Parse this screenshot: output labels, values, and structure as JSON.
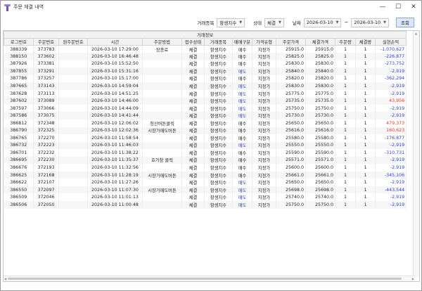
{
  "window": {
    "title": "주문 체결 내역",
    "controls": {
      "minimize": "—",
      "maximize": "☐",
      "close": "✕"
    }
  },
  "toolbar": {
    "product_label": "거래종목",
    "product_value": "항셍지수",
    "status_label": "상태",
    "status_value": "체결",
    "date_label": "날짜",
    "date_from": "2026-03-10",
    "date_sep": "~",
    "date_to": "2026-03-10",
    "search_label": "조회"
  },
  "grid": {
    "group_header": "거래정보",
    "columns": [
      "로그번호",
      "주문번호",
      "원주문번호",
      "시간",
      "주문방법",
      "접수상태",
      "거래종목",
      "매매구분",
      "가격유형",
      "주문가격",
      "체결가격",
      "주문량",
      "체결량",
      "실현손익"
    ],
    "rows": [
      [
        "388339",
        "373783",
        "",
        "2026-03-10 17:29:00",
        "장종료",
        "체결",
        "항셍지수",
        "매수",
        "지정가",
        "25915.0",
        "25915.0",
        "1",
        "1",
        "-1,070,627"
      ],
      [
        "388150",
        "373602",
        "",
        "2026-03-10 16:46:48",
        "",
        "체결",
        "항셍지수",
        "매수",
        "지정가",
        "25825.0",
        "25825.0",
        "1",
        "1",
        "-226,877"
      ],
      [
        "387926",
        "373381",
        "",
        "2026-03-10 15:52:50",
        "",
        "체결",
        "항셍지수",
        "매수",
        "지정가",
        "25830.0",
        "25830.0",
        "1",
        "1",
        "-273,752"
      ],
      [
        "387855",
        "373291",
        "",
        "2026-03-10 15:31:16",
        "",
        "체결",
        "항셍지수",
        "매도",
        "지정가",
        "25840.0",
        "25840.0",
        "1",
        "1",
        "-2,919"
      ],
      [
        "387786",
        "373257",
        "",
        "2026-03-10 15:17:00",
        "",
        "체결",
        "항셍지수",
        "매수",
        "지정가",
        "25820.0",
        "25820.0",
        "1",
        "1",
        "-362,294"
      ],
      [
        "387665",
        "373143",
        "",
        "2026-03-10 14:59:04",
        "",
        "체결",
        "항셍지수",
        "매도",
        "지정가",
        "25830.0",
        "25830.0",
        "1",
        "1",
        "-2,919"
      ],
      [
        "387628",
        "373113",
        "",
        "2026-03-10 14:51:25",
        "",
        "체결",
        "항셍지수",
        "매도",
        "지정가",
        "25775.0",
        "25775.0",
        "1",
        "1",
        "-2,919"
      ],
      [
        "387602",
        "373089",
        "",
        "2026-03-10 14:46:00",
        "",
        "체결",
        "항셍지수",
        "매도",
        "지정가",
        "25735.0",
        "25735.0",
        "1",
        "1",
        "43,956"
      ],
      [
        "387597",
        "373066",
        "",
        "2026-03-10 14:44:09",
        "",
        "체결",
        "항셍지수",
        "매도",
        "지정가",
        "25750.0",
        "25750.0",
        "1",
        "1",
        "-2,919"
      ],
      [
        "387586",
        "373075",
        "",
        "2026-03-10 14:41:44",
        "",
        "체결",
        "항셍지수",
        "매도",
        "지정가",
        "25730.0",
        "25730.0",
        "1",
        "1",
        "-2,919"
      ],
      [
        "386812",
        "372348",
        "",
        "2026-03-10 12:06:02",
        "청산버튼클릭",
        "체결",
        "항셍지수",
        "매수",
        "지정가",
        "25650.0",
        "25650.0",
        "1",
        "1",
        "479,373"
      ],
      [
        "386790",
        "372325",
        "",
        "2026-03-10 12:02:36",
        "시장가매도버튼",
        "체결",
        "항셍지수",
        "매수",
        "지정가",
        "25616.0",
        "25616.0",
        "1",
        "1",
        "160,623"
      ],
      [
        "386765",
        "372270",
        "",
        "2026-03-10 11:58:54",
        "",
        "체결",
        "항셍지수",
        "매수",
        "지정가",
        "25580.0",
        "25580.0",
        "1",
        "1",
        "-176,877"
      ],
      [
        "386732",
        "372223",
        "",
        "2026-03-10 11:46:03",
        "",
        "체결",
        "항셍지수",
        "매도",
        "지정가",
        "25550.0",
        "25550.0",
        "1",
        "1",
        "-2,919"
      ],
      [
        "386701",
        "372232",
        "",
        "2026-03-10 11:38:22",
        "",
        "체결",
        "항셍지수",
        "매수",
        "지정가",
        "25590.0",
        "25590.0",
        "1",
        "1",
        "-310,731"
      ],
      [
        "386695",
        "372230",
        "",
        "2026-03-10 11:35:37",
        "호가창 클릭",
        "체결",
        "항셍지수",
        "매수",
        "지정가",
        "25571.0",
        "25571.0",
        "1",
        "1",
        "-2,919"
      ],
      [
        "386676",
        "372193",
        "",
        "2026-03-10 11:32:56",
        "",
        "체결",
        "항셍지수",
        "매수",
        "지정가",
        "25600.0",
        "25600.0",
        "1",
        "1",
        "-2,919"
      ],
      [
        "386625",
        "372168",
        "",
        "2026-03-10 11:28:19",
        "시장가매도버튼",
        "체결",
        "항셍지수",
        "매수",
        "지정가",
        "25661.0",
        "25661.0",
        "1",
        "1",
        "-345,106"
      ],
      [
        "386622",
        "372107",
        "",
        "2026-03-10 11:27:26",
        "",
        "체결",
        "항셍지수",
        "매도",
        "지정가",
        "25650.0",
        "25650.0",
        "1",
        "1",
        "-2,919"
      ],
      [
        "386550",
        "372097",
        "",
        "2026-03-10 11:07:30",
        "시장가매도버튼",
        "체결",
        "항셍지수",
        "매도",
        "지정가",
        "25698.0",
        "25698.0",
        "1",
        "1",
        "-443,544"
      ],
      [
        "386509",
        "372046",
        "",
        "2026-03-10 11:01:13",
        "",
        "체결",
        "항셍지수",
        "매도",
        "지정가",
        "25740.0",
        "25740.0",
        "1",
        "1",
        "-2,919"
      ],
      [
        "386506",
        "372050",
        "",
        "2026-03-10 11:00:48",
        "",
        "체결",
        "항셍지수",
        "매도",
        "지정가",
        "25750.0",
        "25750.0",
        "1",
        "1",
        "-2,919"
      ]
    ]
  },
  "colors": {
    "loss": "#2a3fc7",
    "profit": "#e0392b",
    "sell": "#2a3fc7",
    "button_bg": "#dbe6fb",
    "header_bg": "#f2f2f2"
  }
}
